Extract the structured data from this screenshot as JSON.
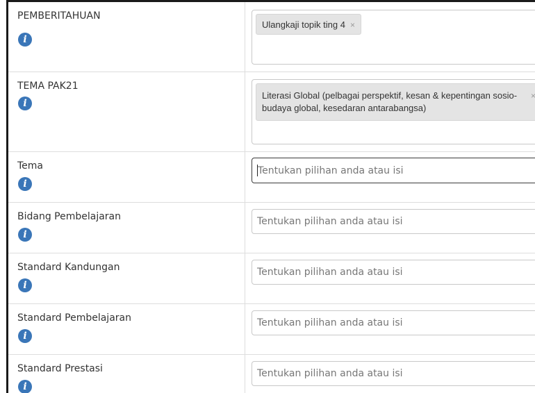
{
  "rows": [
    {
      "label": "PEMBERITAHUAN",
      "tag": "Ulangkaji topik ting 4",
      "tag_remove": "×"
    },
    {
      "label": "TEMA PAK21",
      "tag": "Literasi Global (pelbagai perspektif, kesan & kepentingan sosio-budaya global, kesedaran antarabangsa)",
      "tag_remove": "×"
    },
    {
      "label": "Tema",
      "placeholder": "Tentukan pilihan anda atau isi"
    },
    {
      "label": "Bidang Pembelajaran",
      "placeholder": "Tentukan pilihan anda atau isi"
    },
    {
      "label": "Standard Kandungan",
      "placeholder": "Tentukan pilihan anda atau isi"
    },
    {
      "label": "Standard Pembelajaran",
      "placeholder": "Tentukan pilihan anda atau isi"
    },
    {
      "label": "Standard Prestasi",
      "placeholder": "Tentukan pilihan anda atau isi"
    }
  ],
  "info_icon_glyph": "i",
  "icons": {
    "info": "info-icon",
    "remove": "close-icon"
  },
  "colors": {
    "info_icon": "#3a76b8",
    "tag_background": "#e4e4e4",
    "border": "#dddddd",
    "placeholder_text": "#777777"
  }
}
